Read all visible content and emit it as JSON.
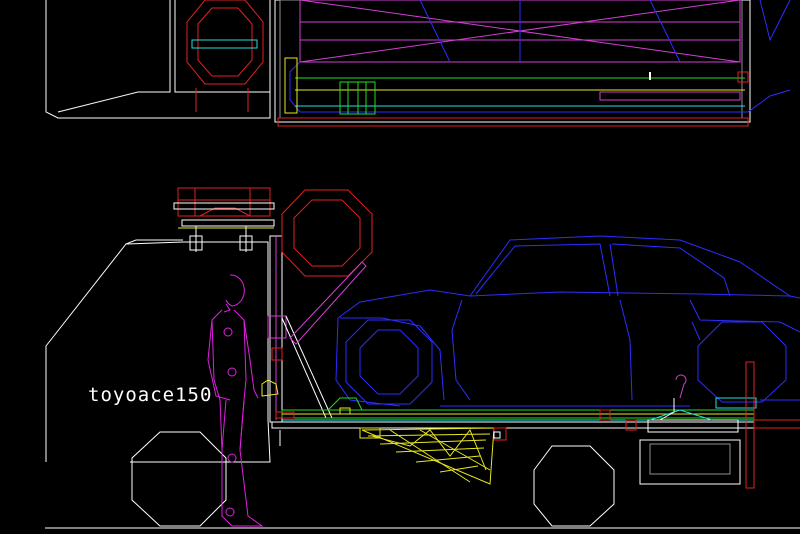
{
  "drawing": {
    "label_text": "toyoace150",
    "colors": {
      "background": "#000000",
      "truck_outline": "#ffffff",
      "car_body": "#2d2dff",
      "figure": "#e020e0",
      "tire_red": "#e02020",
      "frame_green": "#20e020",
      "ramp_yellow": "#e8e820",
      "cyan_parts": "#20e0e0",
      "magenta_lines": "#d040d0",
      "grey": "#909090"
    }
  }
}
